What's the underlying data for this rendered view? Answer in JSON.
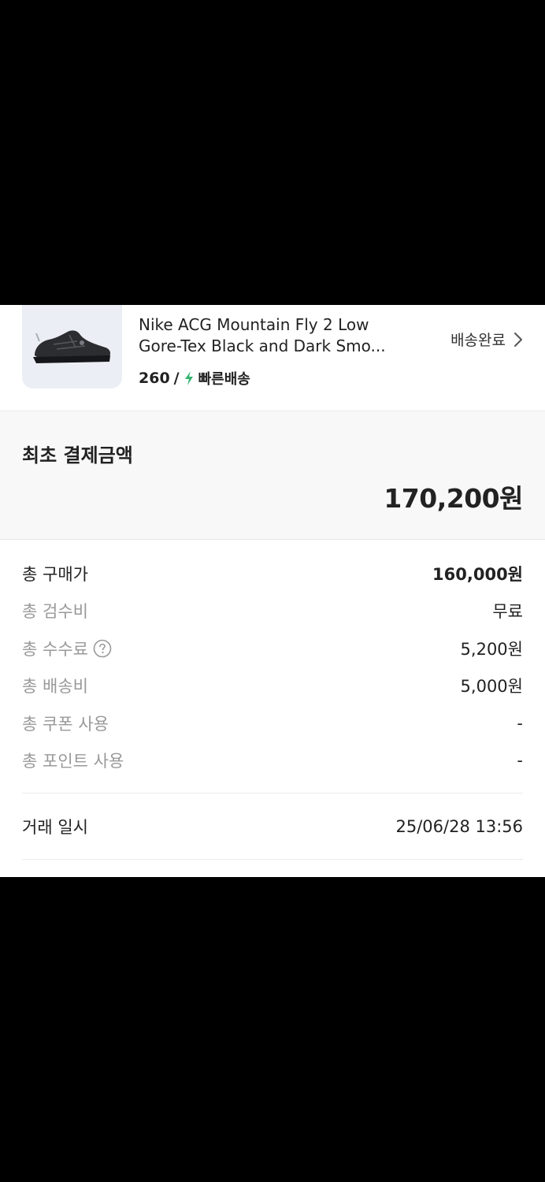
{
  "product": {
    "name_line1": "Nike ACG Mountain Fly 2 Low",
    "name_line2": "Gore-Tex Black and Dark Smo...",
    "size": "260",
    "separator": "/",
    "express_label": "빠른배송",
    "status_label": "배송완료",
    "thumb_bg": "#ebeef4",
    "bolt_color": "#31b46e"
  },
  "initial_payment": {
    "label": "최초 결제금액",
    "amount": "170,200원"
  },
  "breakdown": [
    {
      "label": "총 구매가",
      "value": "160,000원"
    },
    {
      "label": "총 검수비",
      "value": "무료"
    },
    {
      "label": "총 수수료",
      "value": "5,200원"
    },
    {
      "label": "총 배송비",
      "value": "5,000원"
    },
    {
      "label": "총 쿠폰 사용",
      "value": "-"
    },
    {
      "label": "총 포인트 사용",
      "value": "-"
    }
  ],
  "trade": {
    "label": "거래 일시",
    "value": "25/06/28 13:56"
  }
}
